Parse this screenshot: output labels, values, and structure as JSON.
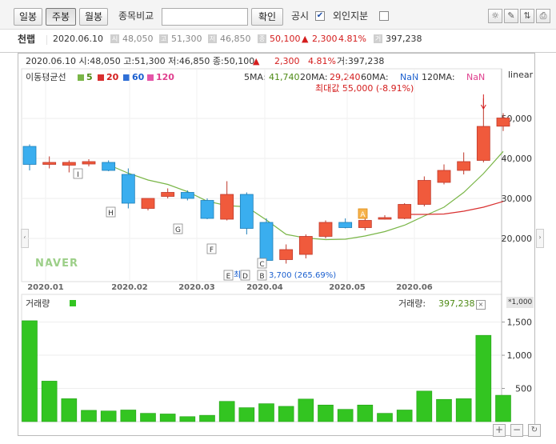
{
  "toolbar": {
    "period_daily": "일봉",
    "period_weekly": "주봉",
    "period_monthly": "월봉",
    "compare_label": "종목비교",
    "compare_value": "",
    "confirm_label": "확인",
    "disclosure_label": "공시",
    "disclosure_checked": true,
    "foreign_label": "외인지분",
    "foreign_checked": false
  },
  "quote": {
    "name": "천랩",
    "date": "2020.06.10",
    "open_icon": "시",
    "open": "48,050",
    "high_icon": "고",
    "high": "51,300",
    "low_icon": "저",
    "low": "46,850",
    "close_icon": "종",
    "close": "50,100",
    "change_arrow": "▲",
    "change": "2,300",
    "change_pct": "4.81%",
    "volume_icon": "거",
    "volume": "397,238"
  },
  "chart_header": {
    "line": "2020.06.10 시:48,050 고:51,300 저:46,850 종:50,100",
    "arrow": "▲",
    "change": "2,300",
    "pct": "4.81%",
    "volume": "거:397,238",
    "scale_mode": "linear",
    "ma_title": "이동평균선",
    "ma_legend": [
      "5",
      "20",
      "60",
      "120"
    ],
    "ma_values": {
      "ma5_label": "5MA:",
      "ma5": "41,740",
      "ma20_label": "20MA:",
      "ma20": "29,240",
      "ma60_label": "60MA:",
      "ma60": "NaN",
      "ma120_label": "120MA:",
      "ma120": "NaN"
    },
    "max_label": "최대값 55,000 (-8.91%)",
    "min_label_prefix": "최",
    "min_label": "3,700 (265.69%)",
    "watermark": "NAVER"
  },
  "volume_header": {
    "title": "거래량",
    "value_label": "거래량:",
    "value": "397,238",
    "unit": "*1,000"
  },
  "colors": {
    "up": "#f05a3c",
    "down": "#3aaeef",
    "ma5": "#7ab648",
    "ma20": "#d93030",
    "ma60": "#2f6fd6",
    "ma120": "#e455a8",
    "volume": "#33c521"
  },
  "chart_data": {
    "type": "candlestick",
    "x_labels": [
      "2020.01",
      "2020.02",
      "2020.03",
      "2020.04",
      "2020.05",
      "2020.06"
    ],
    "price_ticks": [
      "20,000",
      "30,000",
      "40,000",
      "50,000"
    ],
    "volume_ticks": [
      "500",
      "1,000",
      "1,500"
    ],
    "price_ylim": [
      10000,
      58000
    ],
    "volume_ylim": [
      0,
      1700
    ],
    "series": [
      {
        "name": "w01",
        "open": 43000,
        "high": 43500,
        "low": 37000,
        "close": 38500,
        "volume": 1520
      },
      {
        "name": "w02",
        "open": 38500,
        "high": 40500,
        "low": 37500,
        "close": 39000,
        "volume": 610
      },
      {
        "name": "w03",
        "open": 38300,
        "high": 39500,
        "low": 36500,
        "close": 39000,
        "volume": 345
      },
      {
        "name": "w04",
        "open": 38600,
        "high": 39800,
        "low": 38000,
        "close": 39200,
        "volume": 170
      },
      {
        "name": "w05",
        "open": 39000,
        "high": 39500,
        "low": 36800,
        "close": 37000,
        "volume": 160
      },
      {
        "name": "w06",
        "open": 36000,
        "high": 37500,
        "low": 27500,
        "close": 28800,
        "volume": 175
      },
      {
        "name": "w07",
        "open": 27500,
        "high": 30000,
        "low": 27000,
        "close": 30000,
        "volume": 125
      },
      {
        "name": "w08",
        "open": 30500,
        "high": 32500,
        "low": 30000,
        "close": 31500,
        "volume": 115
      },
      {
        "name": "w09",
        "open": 31500,
        "high": 32000,
        "low": 29500,
        "close": 30000,
        "volume": 75
      },
      {
        "name": "w10",
        "open": 29500,
        "high": 30000,
        "low": 24800,
        "close": 25000,
        "volume": 95
      },
      {
        "name": "w11",
        "open": 24800,
        "high": 34300,
        "low": 24500,
        "close": 31000,
        "volume": 305
      },
      {
        "name": "w12",
        "open": 31000,
        "high": 31500,
        "low": 21000,
        "close": 22500,
        "volume": 210
      },
      {
        "name": "w13",
        "open": 24000,
        "high": 25000,
        "low": 13200,
        "close": 14500,
        "volume": 270
      },
      {
        "name": "w14",
        "open": 14700,
        "high": 18500,
        "low": 13700,
        "close": 17200,
        "volume": 230
      },
      {
        "name": "w15",
        "open": 16000,
        "high": 21000,
        "low": 15000,
        "close": 20500,
        "volume": 340
      },
      {
        "name": "w16",
        "open": 20500,
        "high": 24500,
        "low": 20000,
        "close": 24000,
        "volume": 250
      },
      {
        "name": "w17",
        "open": 24000,
        "high": 25000,
        "low": 22500,
        "close": 22700,
        "volume": 185
      },
      {
        "name": "w18",
        "open": 22700,
        "high": 25000,
        "low": 22000,
        "close": 24500,
        "volume": 250
      },
      {
        "name": "w19",
        "open": 25000,
        "high": 25800,
        "low": 24700,
        "close": 25200,
        "volume": 125
      },
      {
        "name": "w20",
        "open": 25000,
        "high": 28800,
        "low": 24800,
        "close": 28500,
        "volume": 175
      },
      {
        "name": "w21",
        "open": 28500,
        "high": 35500,
        "low": 28000,
        "close": 34500,
        "volume": 460
      },
      {
        "name": "w22",
        "open": 34000,
        "high": 38500,
        "low": 33500,
        "close": 37000,
        "volume": 335
      },
      {
        "name": "w23",
        "open": 37000,
        "high": 41500,
        "low": 36000,
        "close": 39200,
        "volume": 345
      },
      {
        "name": "w24",
        "open": 39500,
        "high": 55000,
        "low": 39000,
        "close": 48000,
        "volume": 1300
      },
      {
        "name": "w25",
        "open": 48050,
        "high": 51300,
        "low": 46850,
        "close": 50100,
        "volume": 397
      }
    ],
    "ma5": [
      null,
      null,
      null,
      null,
      38400,
      36300,
      34600,
      33500,
      31700,
      29300,
      28200,
      27900,
      24600,
      21000,
      20100,
      19700,
      19800,
      20600,
      21700,
      23300,
      25600,
      27800,
      31500,
      36200,
      41740
    ],
    "ma20": [
      null,
      null,
      null,
      null,
      null,
      null,
      null,
      null,
      null,
      null,
      null,
      null,
      null,
      null,
      null,
      null,
      null,
      null,
      null,
      26000,
      26000,
      26100,
      26800,
      27800,
      29240
    ],
    "markers": [
      {
        "label": "I",
        "index": 3
      },
      {
        "label": "H",
        "index": 5
      },
      {
        "label": "G",
        "index": 9
      },
      {
        "label": "F",
        "index": 11
      },
      {
        "label": "E",
        "index": 12
      },
      {
        "label": "D",
        "index": 13
      },
      {
        "label": "C",
        "index": 14
      },
      {
        "label": "B",
        "index": 14
      },
      {
        "label": "A",
        "index": 20
      }
    ]
  }
}
